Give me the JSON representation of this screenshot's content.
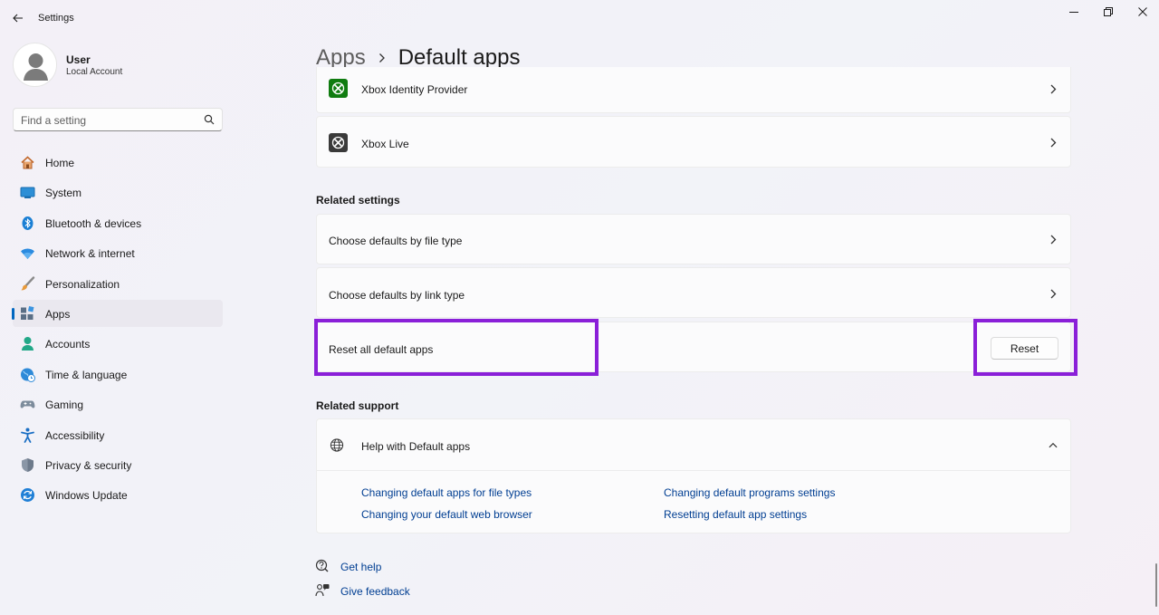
{
  "window": {
    "title": "Settings"
  },
  "profile": {
    "name": "User",
    "account_type": "Local Account"
  },
  "search": {
    "placeholder": "Find a setting"
  },
  "nav": [
    {
      "label": "Home",
      "icon": "home-icon"
    },
    {
      "label": "System",
      "icon": "system-icon"
    },
    {
      "label": "Bluetooth & devices",
      "icon": "bluetooth-icon"
    },
    {
      "label": "Network & internet",
      "icon": "wifi-icon"
    },
    {
      "label": "Personalization",
      "icon": "brush-icon"
    },
    {
      "label": "Apps",
      "icon": "apps-icon",
      "active": true
    },
    {
      "label": "Accounts",
      "icon": "person-icon"
    },
    {
      "label": "Time & language",
      "icon": "clock-globe-icon"
    },
    {
      "label": "Gaming",
      "icon": "gamepad-icon"
    },
    {
      "label": "Accessibility",
      "icon": "accessibility-icon"
    },
    {
      "label": "Privacy & security",
      "icon": "shield-icon"
    },
    {
      "label": "Windows Update",
      "icon": "update-icon"
    }
  ],
  "breadcrumb": {
    "parent": "Apps",
    "current": "Default apps"
  },
  "apps_list": [
    {
      "name": "Xbox Identity Provider",
      "icon": "xbox-green-icon"
    },
    {
      "name": "Xbox Live",
      "icon": "xbox-dark-icon"
    }
  ],
  "related_settings": {
    "title": "Related settings",
    "file_type": "Choose defaults by file type",
    "link_type": "Choose defaults by link type",
    "reset_label": "Reset all default apps",
    "reset_button": "Reset"
  },
  "related_support": {
    "title": "Related support",
    "help_title": "Help with Default apps",
    "links": [
      "Changing default apps for file types",
      "Changing default programs settings",
      "Changing your default web browser",
      "Resetting default app settings"
    ]
  },
  "footer": {
    "get_help": "Get help",
    "give_feedback": "Give feedback"
  },
  "colors": {
    "accent": "#0067c0",
    "link": "#003e92",
    "highlight": "#8a1fd8"
  }
}
